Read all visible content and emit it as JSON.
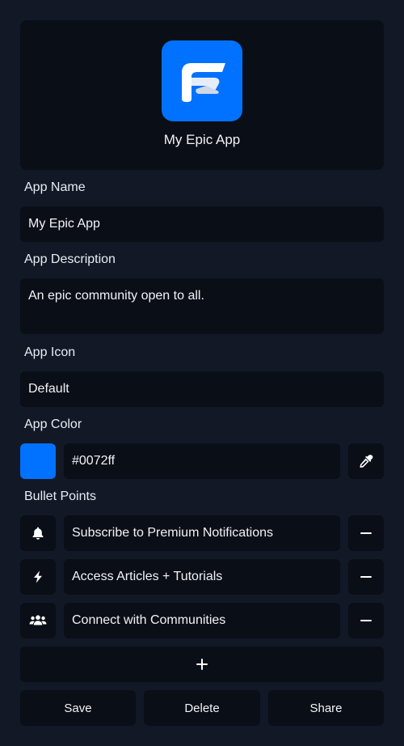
{
  "preview": {
    "app_name": "My Epic App",
    "icon_name": "app-logo-icon",
    "color": "#0072ff"
  },
  "form": {
    "app_name_label": "App Name",
    "app_name_value": "My Epic App",
    "app_description_label": "App Description",
    "app_description_value": "An epic community open to all.",
    "app_icon_label": "App Icon",
    "app_icon_value": "Default",
    "app_color_label": "App Color",
    "app_color_value": "#0072ff",
    "bullet_points_label": "Bullet Points"
  },
  "bullets": [
    {
      "icon": "bell-icon",
      "text": "Subscribe to Premium Notifications"
    },
    {
      "icon": "lightning-icon",
      "text": "Access Articles + Tutorials"
    },
    {
      "icon": "users-icon",
      "text": "Connect with Communities"
    }
  ],
  "actions": {
    "save": "Save",
    "delete": "Delete",
    "share": "Share"
  }
}
